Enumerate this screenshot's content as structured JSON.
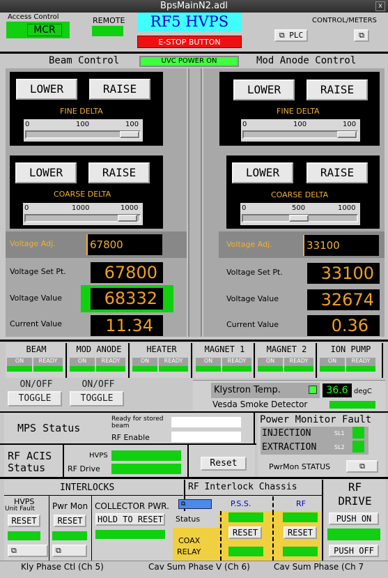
{
  "window": {
    "title": "BpsMainN2.adl",
    "close_label": "x"
  },
  "header": {
    "access_control_label": "Access Control",
    "access_value": "MCR",
    "remote_label": "REMOTE",
    "title": "RF5 HVPS",
    "estop_label": "E-STOP BUTTON",
    "control_meters_label": "CONTROL/METERS",
    "plc_label": "PLC"
  },
  "beam": {
    "title": "Beam Control",
    "fine": {
      "lower": "LOWER",
      "raise": "RAISE",
      "label": "FINE DELTA",
      "min": "0",
      "mid": "100",
      "max": "100",
      "val": "100"
    },
    "coarse": {
      "lower": "LOWER",
      "raise": "RAISE",
      "label": "COARSE DELTA",
      "min": "0",
      "mid": "1000",
      "max": "1000",
      "val": "1000"
    },
    "adj_label": "Voltage Adj.",
    "adj_value": "67800",
    "setpt_label": "Voltage Set Pt.",
    "setpt": "67800",
    "volt_label": "Voltage Value",
    "volt": "68332",
    "curr_label": "Current Value",
    "curr": "11.34"
  },
  "uvc": "UVC POWER ON",
  "mod": {
    "title": "Mod Anode Control",
    "fine": {
      "lower": "LOWER",
      "raise": "RAISE",
      "label": "FINE DELTA",
      "min": "0",
      "mid": "100",
      "max": "100",
      "val": "100"
    },
    "coarse": {
      "lower": "LOWER",
      "raise": "RAISE",
      "label": "COARSE DELTA",
      "min": "0",
      "mid": "500",
      "max": "1000",
      "val": "500"
    },
    "adj_label": "Voltage Adj.",
    "adj_value": "33100",
    "setpt_label": "Voltage Set Pt.",
    "setpt": "33100",
    "volt_label": "Voltage Value",
    "volt": "32674",
    "curr_label": "Current Value",
    "curr": "0.36"
  },
  "status_boxes": [
    {
      "name": "BEAM",
      "on": "ON",
      "ready": "READY"
    },
    {
      "name": "MOD ANODE",
      "on": "ON",
      "ready": "READY"
    },
    {
      "name": "HEATER",
      "on": "ON",
      "ready": "READY"
    },
    {
      "name": "MAGNET 1",
      "on": "ON",
      "ready": "READY"
    },
    {
      "name": "MAGNET 2",
      "on": "ON",
      "ready": "READY"
    },
    {
      "name": "ION PUMP",
      "on": "ON",
      "ready": "READY"
    }
  ],
  "onoff": "ON/OFF",
  "toggle": "TOGGLE",
  "klystron": {
    "label": "Klystron Temp.",
    "value": "36.6",
    "unit": "degC"
  },
  "vesda": "Vesda Smoke Detector",
  "mps": {
    "label": "MPS Status",
    "ready_label": "Ready for stored beam",
    "rf_enable": "RF Enable"
  },
  "pmon": {
    "title": "Power Monitor Fault",
    "injection": "INJECTION",
    "extraction": "EXTRACTION",
    "sl1": "SL1",
    "sl2": "SL2",
    "status": "PwrMon STATUS"
  },
  "acis": {
    "label1": "RF ACIS",
    "label2": "Status",
    "hvps": "HVPS",
    "rfdrive": "RF Drive",
    "reset": "Reset"
  },
  "interlocks": {
    "title": "INTERLOCKS",
    "hvps": "HVPS",
    "unit_fault": "Unit Fault",
    "pwrmon": "Pwr Mon",
    "collector": "COLLECTOR PWR.",
    "reset": "RESET",
    "hold": "HOLD TO RESET"
  },
  "chassis": {
    "title": "RF Interlock Chassis",
    "pss": "P.S.S.",
    "rf": "RF",
    "status": "Status",
    "coax1": "COAX",
    "coax2": "RELAY",
    "reset": "RESET"
  },
  "rfdrive": {
    "title1": "RF",
    "title2": "DRIVE",
    "push_on": "PUSH ON",
    "push_off": "PUSH OFF"
  },
  "footer": {
    "a": "Kly Phase Ctl (Ch 5)",
    "b": "Cav Sum Phase V (Ch 6)",
    "c": "Cav Sum Phase (Ch 7"
  }
}
